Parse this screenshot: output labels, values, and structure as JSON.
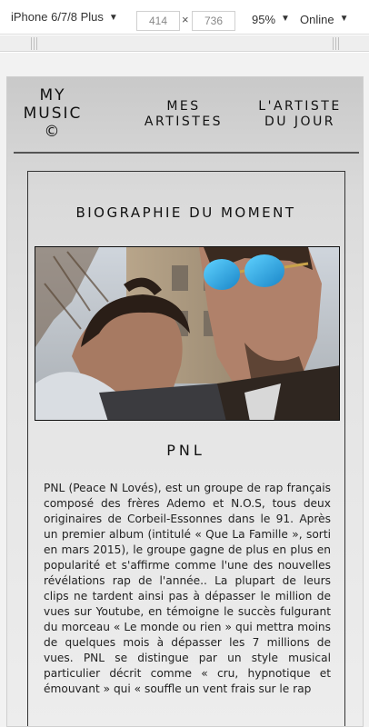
{
  "devtools": {
    "device": "iPhone 6/7/8 Plus",
    "width": "414",
    "separator": "×",
    "height": "736",
    "zoom": "95%",
    "network": "Online"
  },
  "site": {
    "logo": "MY MUSIC ©",
    "nav": [
      "MES ARTISTES",
      "L'ARTISTE DU JOUR"
    ],
    "section_title": "BIOGRAPHIE DU MOMENT",
    "artist_name": "PNL",
    "bio": "PNL (Peace N Lovés), est un groupe de rap français composé des frères Ademo et N.O.S, tous deux originaires de Corbeil-Essonnes dans le 91. Après un premier album (intitulé « Que La Famille », sorti en mars 2015), le groupe gagne de plus en plus en popularité et s'affirme comme l'une des nouvelles révélations rap de l'année.. La plupart de leurs clips ne tardent ainsi pas à dépasser le million de vues sur Youtube, en témoigne le succès fulgurant du morceau « Le monde ou rien » qui mettra moins de quelques mois à dépasser les 7 millions de vues. PNL se distingue par un style musical particulier décrit comme « cru, hypnotique et émouvant » qui « souffle un vent frais sur le rap"
  },
  "icons": {
    "caret": "caret-down-icon"
  }
}
